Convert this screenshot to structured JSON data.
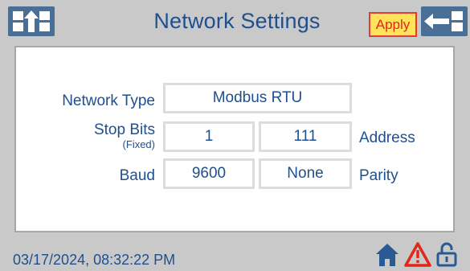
{
  "header": {
    "title": "Network Settings",
    "apply_label": "Apply",
    "left_nav_icon": "swap-up-icon",
    "right_nav_icon": "back-arrow-icon"
  },
  "form": {
    "network_type_label": "Network Type",
    "network_type_value": "Modbus RTU",
    "stop_bits_label": "Stop Bits",
    "stop_bits_note": "(Fixed)",
    "stop_bits_value": "1",
    "address_value": "111",
    "address_label": "Address",
    "baud_label": "Baud",
    "baud_value": "9600",
    "parity_value": "None",
    "parity_label": "Parity"
  },
  "footer": {
    "timestamp": "03/17/2024, 08:32:22 PM",
    "icons": [
      "home-icon",
      "warning-icon",
      "unlock-icon"
    ]
  },
  "colors": {
    "background": "#c9c9c9",
    "text_blue": "#1f4f8f",
    "nav_button": "#4a6f97",
    "apply_fill": "#ffe35a",
    "apply_border": "#e53c2f",
    "warning_red": "#e0271a"
  }
}
